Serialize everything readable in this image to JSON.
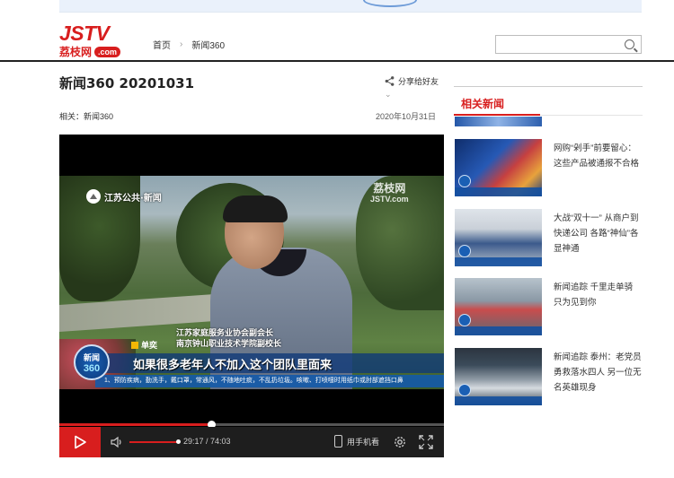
{
  "logo": {
    "top": "JSTV",
    "cn": "荔枝网",
    "com": ".com"
  },
  "breadcrumb": {
    "home": "首页",
    "section": "新闻360"
  },
  "search": {
    "placeholder": "",
    "value": ""
  },
  "article": {
    "title": "新闻360 20201031",
    "share_label": "分享给好友",
    "tag_label": "相关：新闻360",
    "date": "2020年10月31日"
  },
  "video": {
    "channel": "江苏公共·新闻",
    "watermark_cn": "荔枝网",
    "watermark_en": "JSTV.com",
    "speaker_title1": "江苏家庭服务业协会副会长",
    "speaker_title2": "南京钟山职业技术学院副校长",
    "speaker_badge": "单奕",
    "caption": "如果很多老年人不加入这个团队里面来",
    "ticker": "1、预防疾病，勤洗手，戴口罩，常通风，不随地吐痰，不乱扔垃圾。咳嗽、打喷嚏时用纸巾或肘部遮挡口鼻",
    "logo_line1": "新闻",
    "logo_line2": "360",
    "progress": 0.395,
    "volume": 1.0,
    "time_current": "29:17",
    "time_total": "74:03",
    "time_display": "29:17 / 74:03",
    "mobile_label": "用手机看"
  },
  "sidebar": {
    "title": "相关新闻",
    "items": [
      {
        "text": "网购“剁手”前要留心：这些产品被通报不合格"
      },
      {
        "text": "大战“双十一” 从商户到快递公司 各路“神仙”各显神通"
      },
      {
        "text": "新闻追踪 千里走单骑 只为见到你"
      },
      {
        "text": "新闻追踪 泰州：老党员勇救落水四人 另一位无名英雄现身"
      }
    ]
  },
  "colors": {
    "brand": "#d81e1e",
    "text": "#222222",
    "player_bg": "#000000"
  }
}
